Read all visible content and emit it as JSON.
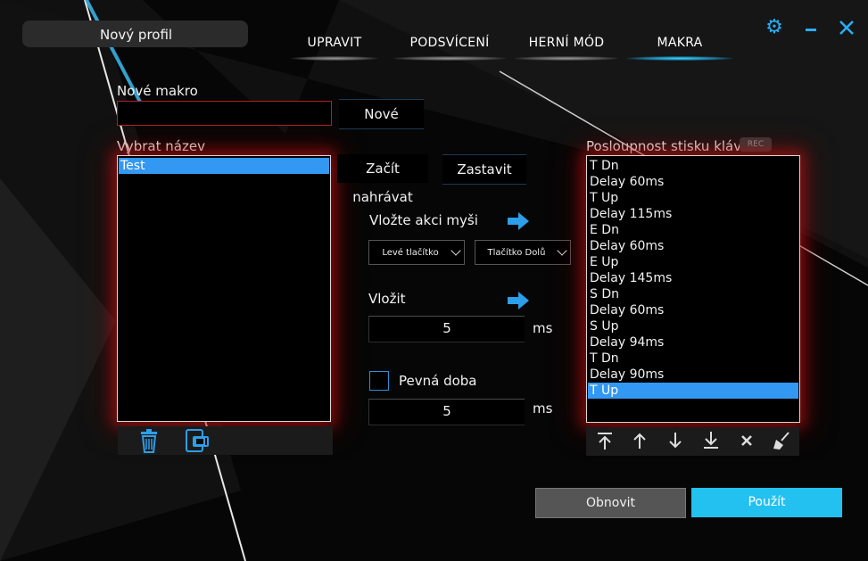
{
  "header": {
    "profile_name": "Nový profil",
    "tabs": [
      {
        "label": "UPRAVIT",
        "active": false
      },
      {
        "label": "PODSVÍCENÍ",
        "active": false
      },
      {
        "label": "HERNÍ MÓD",
        "active": false
      },
      {
        "label": "MAKRA",
        "active": true
      }
    ],
    "icons": [
      "gear-icon",
      "minimize-icon",
      "close-icon"
    ]
  },
  "new_macro": {
    "label": "Nové makro",
    "value": "",
    "button": "Nové"
  },
  "select_name": {
    "label": "Vybrat název",
    "items": [
      "Test"
    ],
    "selected_index": 0,
    "toolbar_icons": [
      "trash-icon",
      "copy-icon"
    ]
  },
  "recording": {
    "start_label": "Začít nahrávat",
    "stop_label": "Zastavit"
  },
  "mouse_action": {
    "label": "Vložte akci myši",
    "button_value": "Levé tlačítko",
    "action_value": "Tlačítko Dolů"
  },
  "insert_delay": {
    "label": "Vložit",
    "value": "5",
    "unit": "ms"
  },
  "fixed_time": {
    "label": "Pevná doba",
    "checked": false,
    "value": "5",
    "unit": "ms"
  },
  "sequence": {
    "label": "Posloupnost stisku kláves",
    "rec_badge": "REC",
    "items": [
      "T Dn",
      "Delay 60ms",
      "T Up",
      "Delay 115ms",
      "E Dn",
      "Delay 60ms",
      "E Up",
      "Delay 145ms",
      "S Dn",
      "Delay 60ms",
      "S Up",
      "Delay 94ms",
      "T Dn",
      "Delay 90ms",
      "T Up"
    ],
    "selected_index": 14,
    "toolbar_icons": [
      "move-top-icon",
      "move-up-icon",
      "move-down-icon",
      "move-bottom-icon",
      "delete-icon",
      "clear-icon"
    ]
  },
  "footer": {
    "reset_label": "Obnovit",
    "apply_label": "Použít"
  },
  "colors": {
    "accent": "#29aef5",
    "selection": "#3398f2",
    "apply": "#22c1f0",
    "glow": "#c81414"
  }
}
